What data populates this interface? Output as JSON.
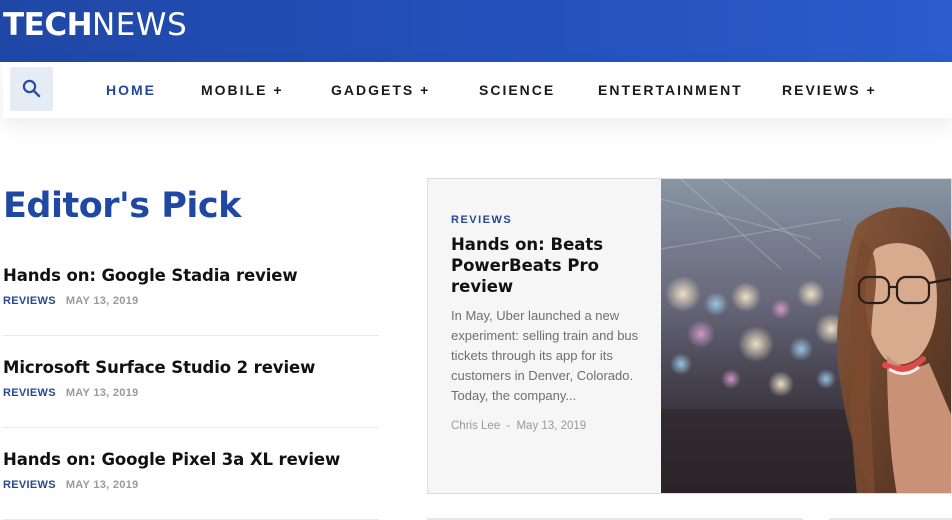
{
  "header": {
    "logo_bold": "TECH",
    "logo_light": "NEWS",
    "brand_color": "#2350ba"
  },
  "nav": {
    "search_icon": "search-icon",
    "items": [
      {
        "label": "HOME",
        "active": true
      },
      {
        "label": "MOBILE +"
      },
      {
        "label": "GADGETS +"
      },
      {
        "label": "SCIENCE"
      },
      {
        "label": "ENTERTAINMENT"
      },
      {
        "label": "REVIEWS +"
      }
    ]
  },
  "editors_pick": {
    "heading": "Editor's Pick",
    "articles": [
      {
        "title": "Hands on: Google Stadia review",
        "category": "REVIEWS",
        "date": "MAY 13, 2019"
      },
      {
        "title": "Microsoft Surface Studio 2 review",
        "category": "REVIEWS",
        "date": "MAY 13, 2019"
      },
      {
        "title": "Hands on: Google Pixel 3a XL review",
        "category": "REVIEWS",
        "date": "MAY 13, 2019"
      }
    ]
  },
  "featured": {
    "category": "REVIEWS",
    "title": "Hands on: Beats PowerBeats Pro review",
    "excerpt": "In May, Uber launched a new experiment: selling train and bus tickets through its app for its customers in Denver, Colorado. Today, the company...",
    "author": "Chris Lee",
    "separator": "-",
    "date": "May 13, 2019"
  }
}
